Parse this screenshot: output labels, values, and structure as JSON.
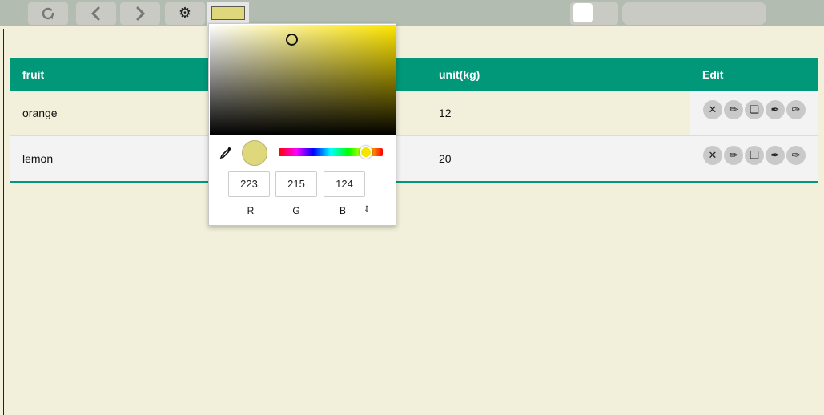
{
  "toolbar": {
    "refresh_icon": "refresh-icon",
    "back_icon": "chevron-left-icon",
    "forward_icon": "chevron-right-icon",
    "settings_glyph": "⚙",
    "swatch_color": "#dfd77c"
  },
  "table": {
    "headers": [
      "fruit",
      "unit(kg)",
      "Edit"
    ],
    "rows": [
      {
        "fruit": "orange",
        "unit": "12"
      },
      {
        "fruit": "lemon",
        "unit": "20"
      }
    ],
    "actions": [
      "✕",
      "✏",
      "❏",
      "✒",
      "✑"
    ],
    "accent": "#009879"
  },
  "picker": {
    "current_color": "#dfd77c",
    "hue_color": "#ffe600",
    "r": "223",
    "g": "215",
    "b": "124",
    "label_r": "R",
    "label_g": "G",
    "label_b": "B",
    "mode_toggle": "⇕"
  }
}
